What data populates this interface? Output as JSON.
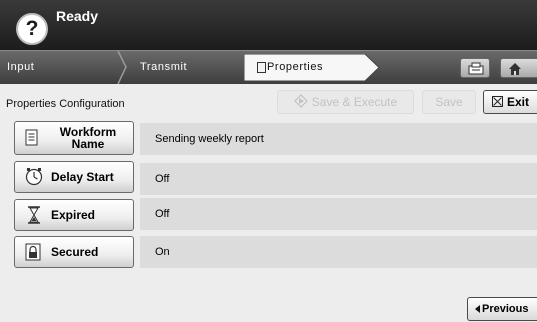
{
  "status": {
    "help_label": "?",
    "text": "Ready"
  },
  "tabs": [
    {
      "label": "Input"
    },
    {
      "label": "Transmit"
    },
    {
      "label": "Properties",
      "icon": "document-icon",
      "selected": true
    }
  ],
  "tab_icons": [
    "tray-icon",
    "home-icon"
  ],
  "toolbar": {
    "section_title": "Properties Configuration",
    "save_execute_label": "Save & Execute",
    "save_label": "Save",
    "exit_label": "Exit"
  },
  "properties": [
    {
      "name": "Workform Name",
      "icon": "document-icon",
      "value": "Sending weekly report"
    },
    {
      "name": "Delay Start",
      "icon": "clock-icon",
      "value": "Off"
    },
    {
      "name": "Expired",
      "icon": "hourglass-icon",
      "value": "Off"
    },
    {
      "name": "Secured",
      "icon": "lock-icon",
      "value": "On"
    }
  ],
  "footer": {
    "previous_label": "Previous"
  },
  "colors": {
    "status_bar": "#2a2a2a",
    "tab_bar": "#545454",
    "background": "#ededed",
    "value_field": "#dcdcdc"
  }
}
